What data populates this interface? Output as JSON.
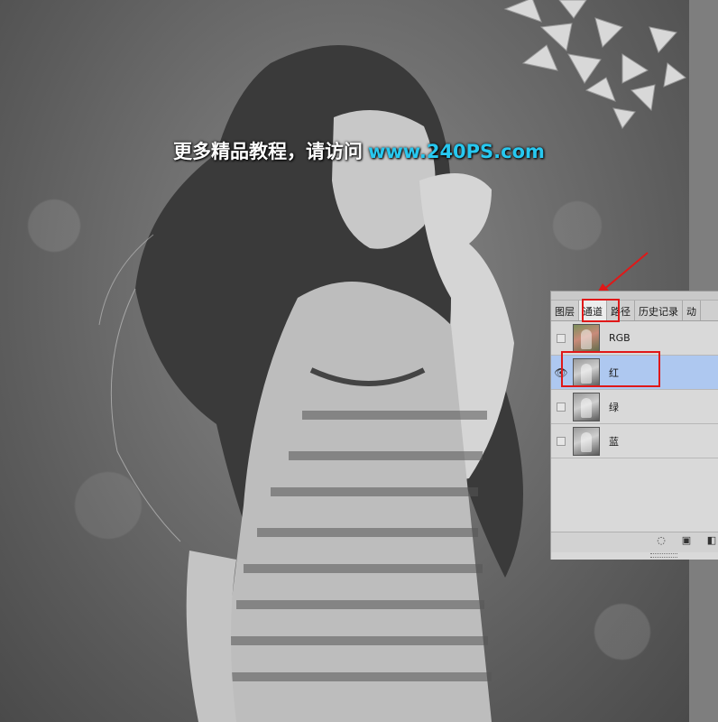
{
  "watermark": {
    "chinese": "更多精品教程，请访问",
    "url": "www.240PS.com"
  },
  "channels_panel": {
    "tabs": [
      {
        "label": "图层",
        "active": false
      },
      {
        "label": "通道",
        "active": true
      },
      {
        "label": "路径",
        "active": false
      },
      {
        "label": "历史记录",
        "active": false
      },
      {
        "label": "动",
        "active": false
      }
    ],
    "channels": [
      {
        "name": "RGB",
        "visible": false,
        "selected": false
      },
      {
        "name": "红",
        "visible": true,
        "selected": true
      },
      {
        "name": "绿",
        "visible": false,
        "selected": false
      },
      {
        "name": "蓝",
        "visible": false,
        "selected": false
      }
    ],
    "bottom_icons": [
      "load-selection-icon",
      "save-selection-icon",
      "new-channel-icon"
    ]
  },
  "colors": {
    "highlight": "#e01818",
    "selected_row": "#aec8f0",
    "url_text": "#27c8f0"
  }
}
